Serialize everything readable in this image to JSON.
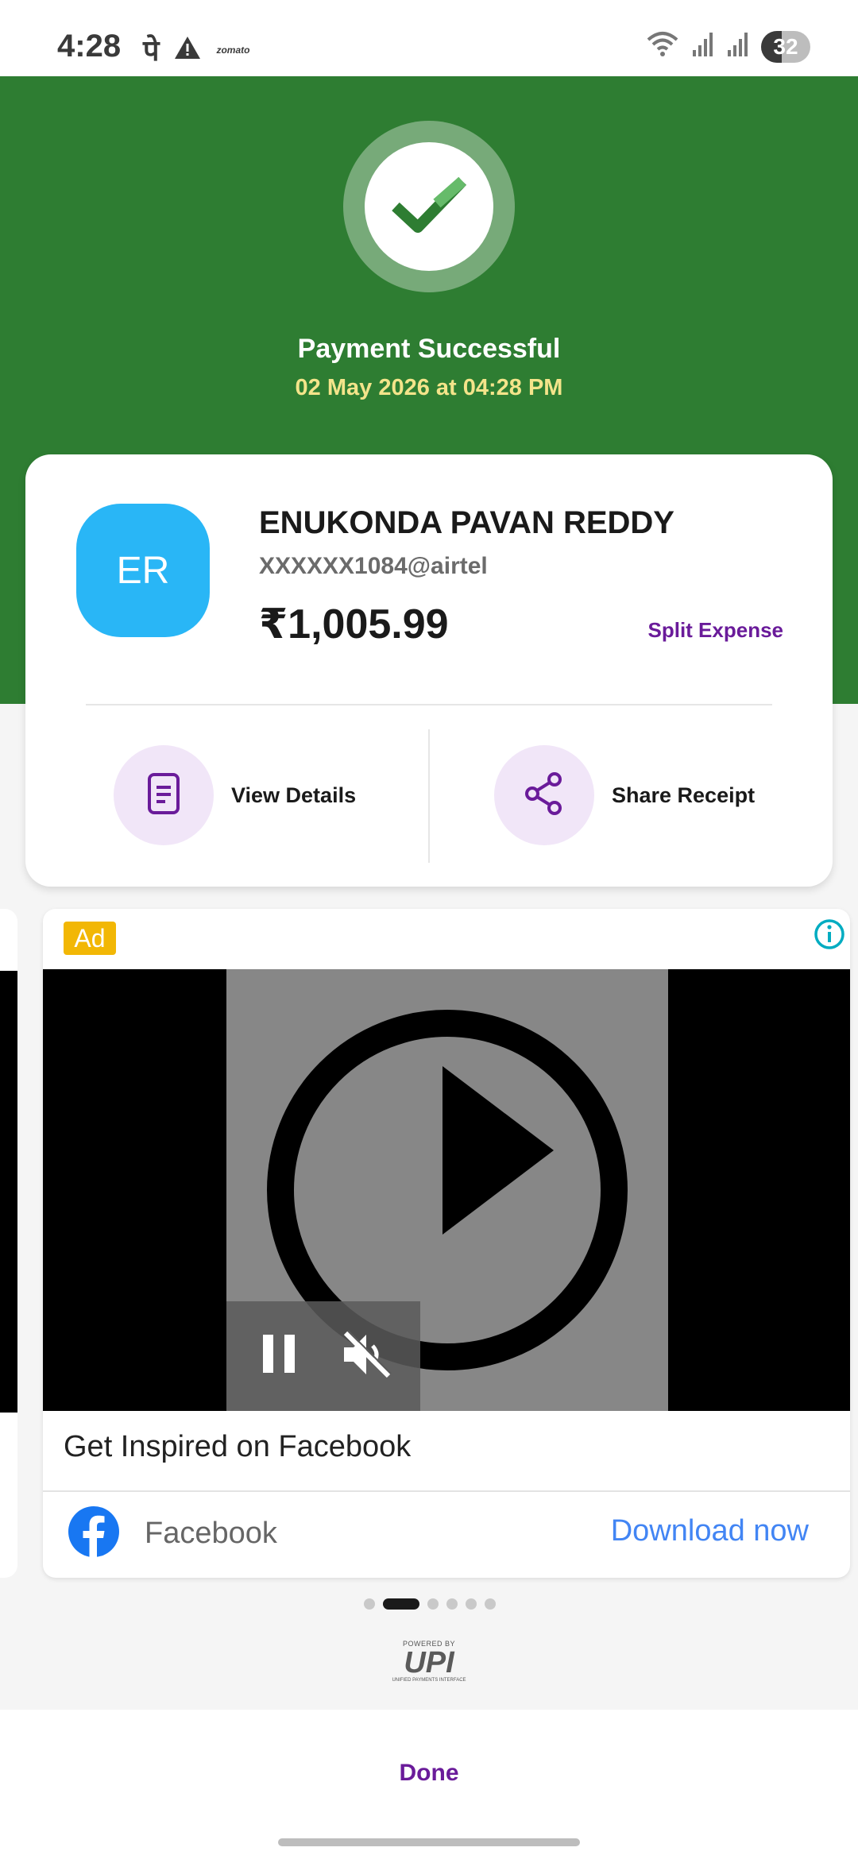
{
  "status_bar": {
    "time": "4:28",
    "pe_glyph": "पे",
    "zomato_label": "zomato",
    "battery": "32",
    "icons": [
      "warning-icon",
      "wifi-icon",
      "signal-icon",
      "signal-icon",
      "battery-icon"
    ]
  },
  "header": {
    "title": "Payment Successful",
    "datetime": "02 May 2026 at 04:28 PM",
    "colors": {
      "background": "#2e7d32",
      "date": "#f3e48a"
    }
  },
  "payee": {
    "initials": "ER",
    "name": "ENUKONDA PAVAN REDDY",
    "upi_id": "XXXXXX1084@airtel",
    "amount": "₹1,005.99",
    "split_label": "Split Expense"
  },
  "actions": {
    "view_details": "View Details",
    "share_receipt": "Share Receipt"
  },
  "ad": {
    "badge": "Ad",
    "title": "Get Inspired on Facebook",
    "brand": "Facebook",
    "cta": "Download now"
  },
  "carousel": {
    "total": 6,
    "active": 1
  },
  "upi": {
    "powered_by": "POWERED BY",
    "logo": "UPI",
    "tagline": "UNIFIED PAYMENTS INTERFACE"
  },
  "footer": {
    "done_label": "Done"
  },
  "accent_color": "#6a1b9a"
}
